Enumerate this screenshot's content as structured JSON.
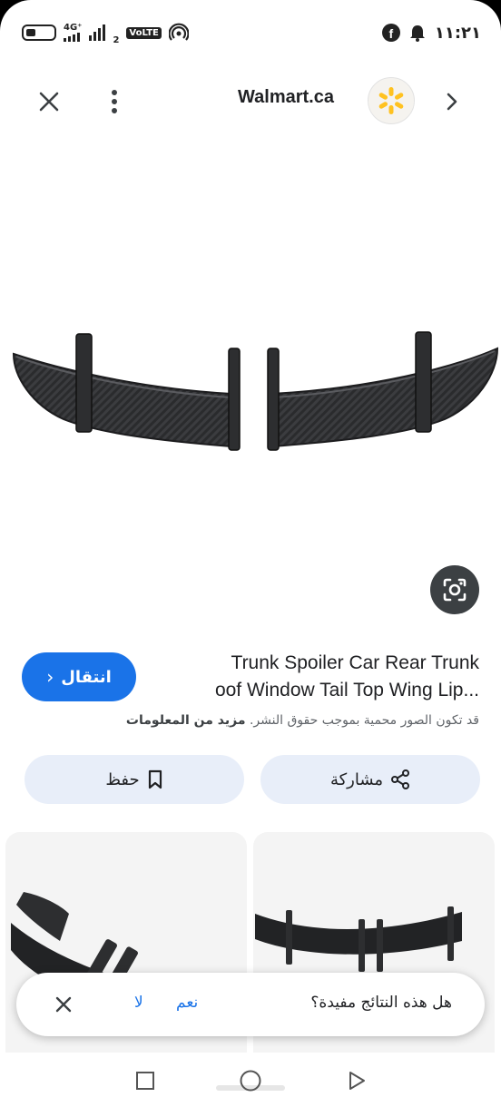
{
  "status_bar": {
    "time": "١١:٢١",
    "network_label": "4G⁺",
    "sim_slot": "2",
    "volte_label": "VoLTE"
  },
  "top_bar": {
    "site_name": "Walmart.ca",
    "icons": [
      "close-icon",
      "more-vert-icon",
      "walmart-spark-logo",
      "chevron-right-icon"
    ]
  },
  "product": {
    "title_line1": "Trunk Spoiler Car Rear Trunk",
    "title_line2": "oof Window Tail Top Wing Lip...",
    "goto_label": "انتقال",
    "copyright_text": "قد تكون الصور محمية بموجب حقوق النشر.",
    "more_info_link": "مزيد من المعلومات"
  },
  "actions": {
    "share_label": "مشاركة",
    "save_label": "حفظ"
  },
  "feedback": {
    "question": "هل هذه النتائج مفيدة؟",
    "yes_label": "نعم",
    "no_label": "لا"
  },
  "colors": {
    "accent": "#1a73e8",
    "pill_bg": "#e8eef9",
    "walmart_yellow": "#ffc220"
  }
}
